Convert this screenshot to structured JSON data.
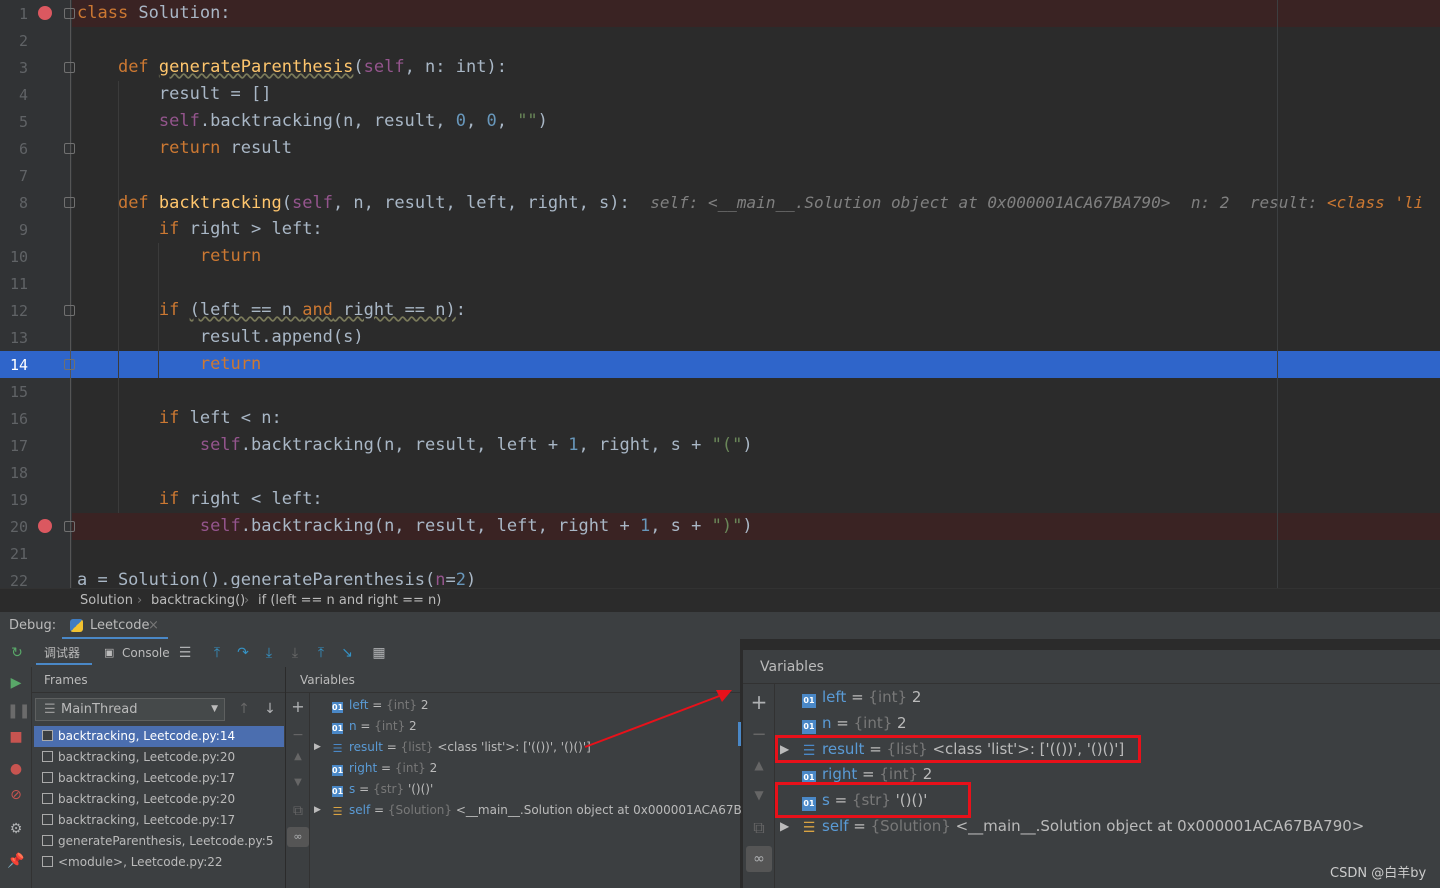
{
  "editor": {
    "lines": [
      "1",
      "2",
      "3",
      "4",
      "5",
      "6",
      "7",
      "8",
      "9",
      "10",
      "11",
      "12",
      "13",
      "14",
      "15",
      "16",
      "17",
      "18",
      "19",
      "20",
      "21",
      "22"
    ],
    "inline_debug": {
      "self": "self: <__main__.Solution object at 0x000001ACA67BA790>",
      "n": "n: 2",
      "result": "result: ",
      "result_class": "<class 'li"
    }
  },
  "breadcrumb": {
    "items": [
      "Solution",
      "backtracking()",
      "if (left == n and right == n)"
    ]
  },
  "debug": {
    "label": "Debug:",
    "tab": "Leetcode",
    "toolbar": {
      "debugger": "调试器",
      "console": "Console"
    },
    "frames": {
      "header": "Frames",
      "thread": "MainThread",
      "items": [
        "backtracking, Leetcode.py:14",
        "backtracking, Leetcode.py:20",
        "backtracking, Leetcode.py:17",
        "backtracking, Leetcode.py:20",
        "backtracking, Leetcode.py:17",
        "generateParenthesis, Leetcode.py:5",
        "<module>, Leetcode.py:22"
      ]
    },
    "variables_header": "Variables",
    "variables": [
      {
        "name": "left",
        "eq": " = ",
        "type": "{int}",
        "value": " 2"
      },
      {
        "name": "n",
        "eq": " = ",
        "type": "{int}",
        "value": " 2"
      },
      {
        "name": "result",
        "eq": " = ",
        "type": "{list}",
        "value": " <class 'list'>: ['(())', '()()']"
      },
      {
        "name": "right",
        "eq": " = ",
        "type": "{int}",
        "value": " 2"
      },
      {
        "name": "s",
        "eq": " = ",
        "type": "{str}",
        "value": " '()()'"
      },
      {
        "name": "self",
        "eq": " = ",
        "type": "{Solution}",
        "value": " <__main__.Solution object at 0x000001ACA67BA790>"
      }
    ]
  },
  "watermark": "CSDN @白羊by"
}
